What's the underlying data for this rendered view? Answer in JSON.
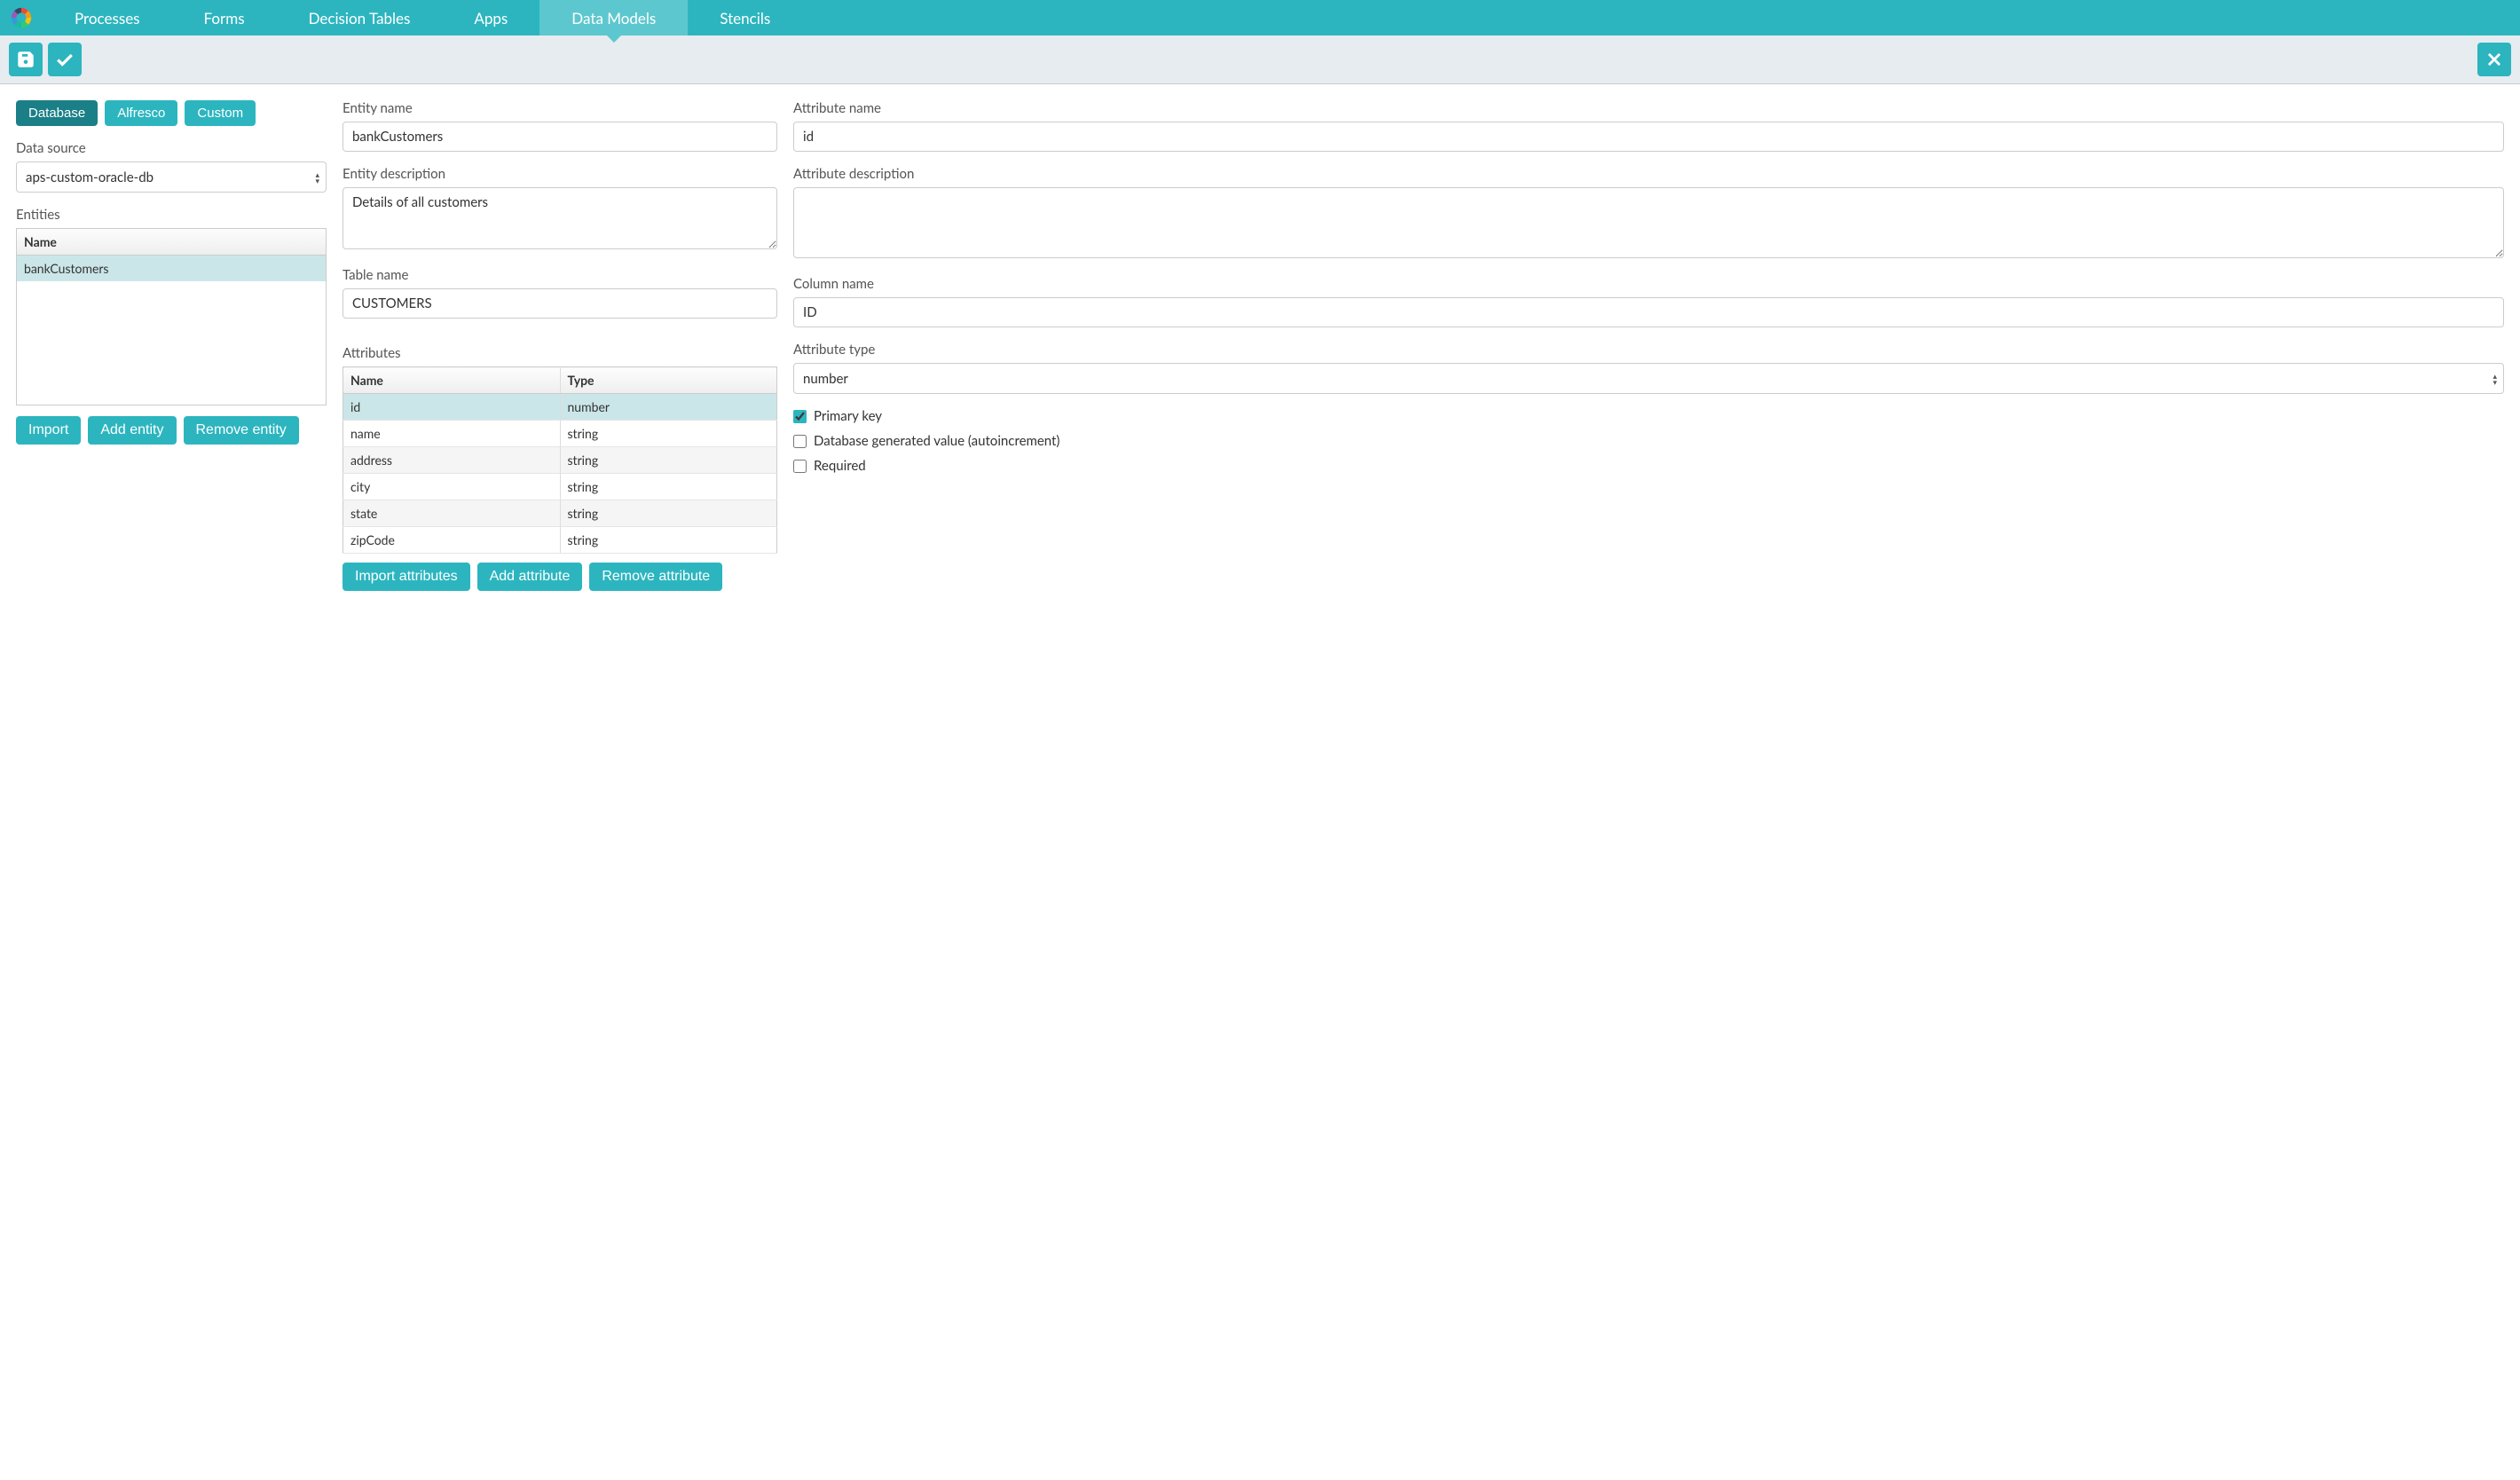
{
  "nav": {
    "items": [
      "Processes",
      "Forms",
      "Decision Tables",
      "Apps",
      "Data Models",
      "Stencils"
    ],
    "activeIndex": 4
  },
  "leftPanel": {
    "tabs": [
      "Database",
      "Alfresco",
      "Custom"
    ],
    "activeTab": 0,
    "dataSourceLabel": "Data source",
    "dataSourceValue": "aps-custom-oracle-db",
    "entitiesLabel": "Entities",
    "entitiesHeader": "Name",
    "entities": [
      "bankCustomers"
    ],
    "selectedEntity": 0,
    "buttons": {
      "import": "Import",
      "add": "Add entity",
      "remove": "Remove entity"
    }
  },
  "entityForm": {
    "entityNameLabel": "Entity name",
    "entityName": "bankCustomers",
    "entityDescLabel": "Entity description",
    "entityDesc": "Details of all customers",
    "tableNameLabel": "Table name",
    "tableName": "CUSTOMERS"
  },
  "attributes": {
    "label": "Attributes",
    "headers": {
      "name": "Name",
      "type": "Type"
    },
    "rows": [
      {
        "name": "id",
        "type": "number"
      },
      {
        "name": "name",
        "type": "string"
      },
      {
        "name": "address",
        "type": "string"
      },
      {
        "name": "city",
        "type": "string"
      },
      {
        "name": "state",
        "type": "string"
      },
      {
        "name": "zipCode",
        "type": "string"
      }
    ],
    "selectedIndex": 0,
    "buttons": {
      "import": "Import attributes",
      "add": "Add attribute",
      "remove": "Remove attribute"
    }
  },
  "attributeForm": {
    "nameLabel": "Attribute name",
    "name": "id",
    "descLabel": "Attribute description",
    "desc": "",
    "columnLabel": "Column name",
    "column": "ID",
    "typeLabel": "Attribute type",
    "type": "number",
    "primaryKeyLabel": "Primary key",
    "primaryKey": true,
    "autoIncLabel": "Database generated value (autoincrement)",
    "autoInc": false,
    "requiredLabel": "Required",
    "required": false
  }
}
